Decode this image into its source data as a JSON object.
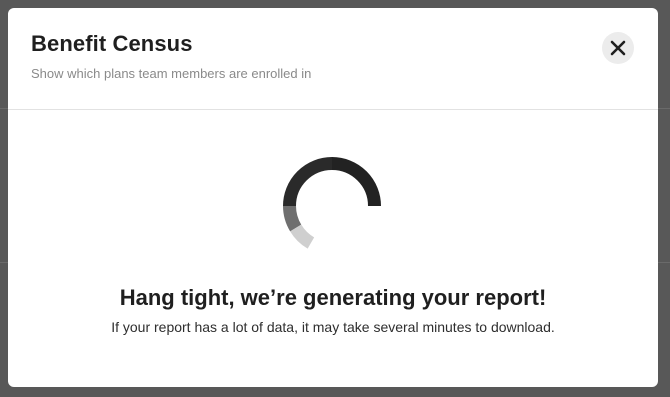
{
  "modal": {
    "title": "Benefit Census",
    "subtitle": "Show which plans team members are enrolled in",
    "close_icon": "close-icon"
  },
  "loading": {
    "spinner_icon": "loading-spinner-icon",
    "heading": "Hang tight, we’re generating your report!",
    "message": "If your report has a lot of data, it may take several minutes to download."
  },
  "colors": {
    "overlay": "#585858",
    "modal_background": "#ffffff",
    "text_primary": "#1f1f1f",
    "text_secondary": "#8a8a8a",
    "close_button_background": "#ececec",
    "spinner": "#222222"
  }
}
